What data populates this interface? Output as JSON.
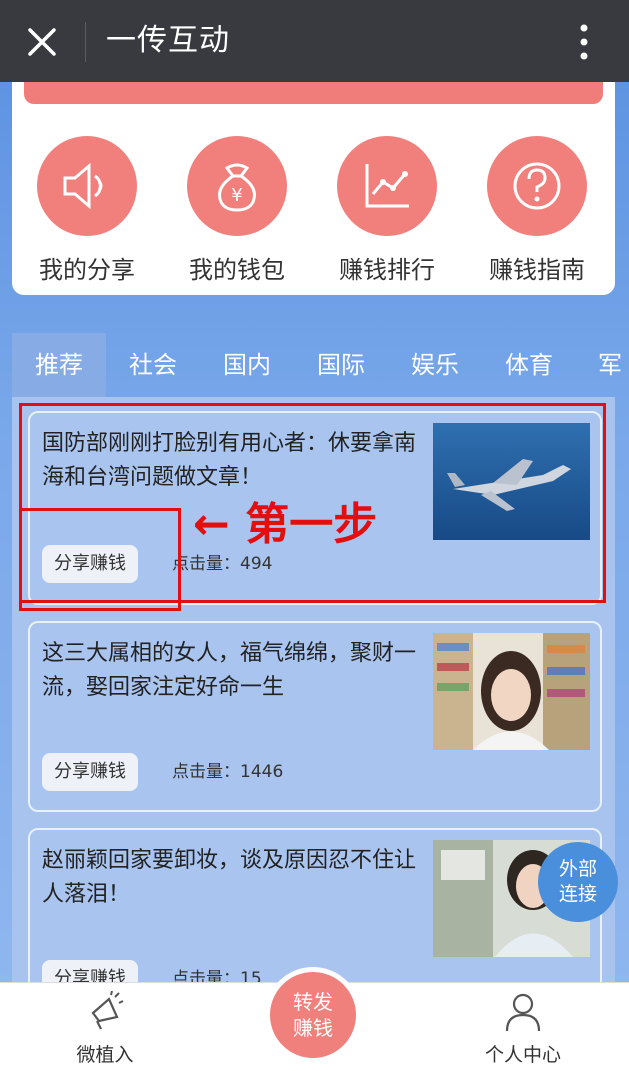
{
  "topbar": {
    "title": "一传互动"
  },
  "menu": [
    {
      "label": "我的分享",
      "icon": "speaker-icon"
    },
    {
      "label": "我的钱包",
      "icon": "money-bag-icon"
    },
    {
      "label": "赚钱排行",
      "icon": "chart-icon"
    },
    {
      "label": "赚钱指南",
      "icon": "question-icon"
    }
  ],
  "tabs": [
    "推荐",
    "社会",
    "国内",
    "国际",
    "娱乐",
    "体育",
    "军"
  ],
  "articles": [
    {
      "headline": "国防部刚刚打脸别有用心者：休要拿南海和台湾问题做文章！",
      "share": "分享赚钱",
      "clicks": "点击量：494"
    },
    {
      "headline": "这三大属相的女人，福气绵绵，聚财一流，娶回家注定好命一生",
      "share": "分享赚钱",
      "clicks": "点击量：1446"
    },
    {
      "headline": "赵丽颖回家要卸妆，谈及原因忍不住让人落泪！",
      "share": "分享赚钱",
      "clicks": "点击量：15"
    }
  ],
  "annotation": {
    "arrow": "←",
    "text": "第一步"
  },
  "external": "外部连接",
  "bottom": {
    "left": "微植入",
    "center": "转发赚钱",
    "right": "个人中心"
  }
}
